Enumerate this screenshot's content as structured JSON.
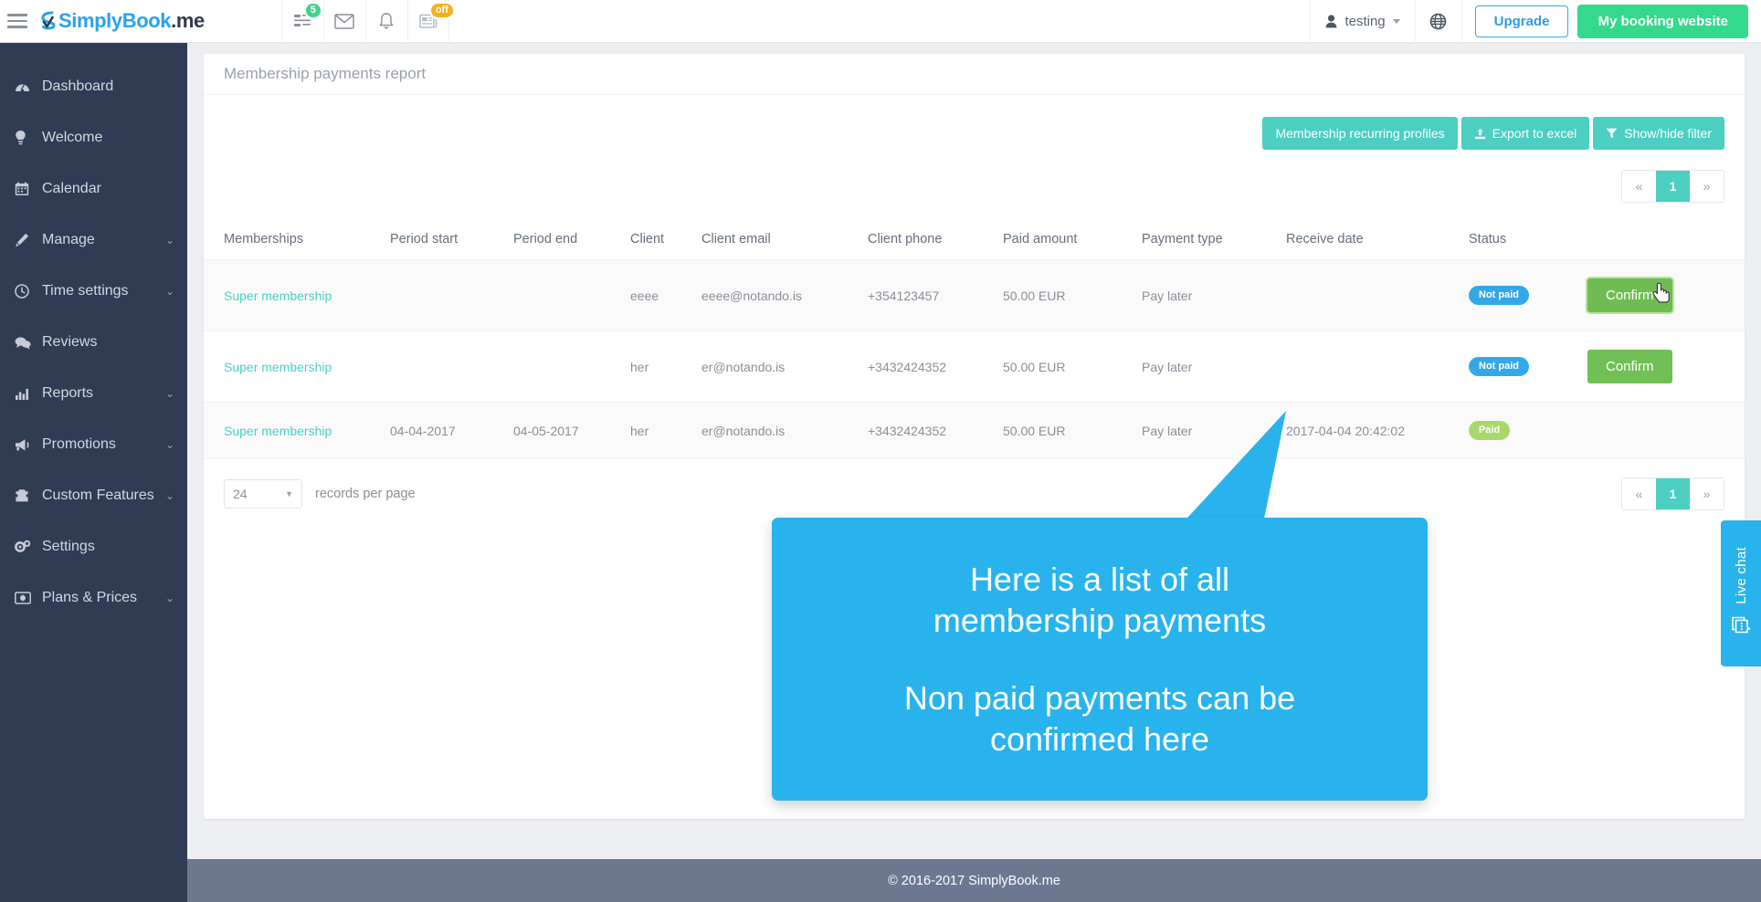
{
  "header": {
    "menu_icon": "hamburger-icon",
    "brand_first": "SimplyBook",
    "brand_second": ".me",
    "icons": [
      {
        "name": "news-feed-icon",
        "badge": "5",
        "badge_color": "#3ed48a"
      },
      {
        "name": "mail-icon",
        "badge": "",
        "badge_color": ""
      },
      {
        "name": "bell-icon",
        "badge": "",
        "badge_color": ""
      },
      {
        "name": "newspaper-icon",
        "badge": "off",
        "badge_color": "#f5b01f"
      }
    ],
    "user_label": "testing",
    "globe_icon": "globe-icon",
    "upgrade_label": "Upgrade",
    "booking_label": "My booking website",
    "accent_blue": "#2f9ae8",
    "accent_green": "#35d98c"
  },
  "sidebar": {
    "items": [
      {
        "label": "Dashboard",
        "icon": "dashboard-icon",
        "arrow": ""
      },
      {
        "label": "Welcome",
        "icon": "bulb-icon",
        "arrow": ""
      },
      {
        "label": "Calendar",
        "icon": "calendar-icon",
        "arrow": ""
      },
      {
        "label": "Manage",
        "icon": "pencil-icon",
        "arrow": "⌄"
      },
      {
        "label": "Time settings",
        "icon": "clock-icon",
        "arrow": "⌄"
      },
      {
        "label": "Reviews",
        "icon": "comments-icon",
        "arrow": ""
      },
      {
        "label": "Reports",
        "icon": "bar-chart-icon",
        "arrow": "⌄"
      },
      {
        "label": "Promotions",
        "icon": "megaphone-icon",
        "arrow": "⌄"
      },
      {
        "label": "Custom Features",
        "icon": "puzzle-icon",
        "arrow": "⌄"
      },
      {
        "label": "Settings",
        "icon": "gears-icon",
        "arrow": ""
      },
      {
        "label": "Plans & Prices",
        "icon": "money-icon",
        "arrow": "⌄"
      }
    ]
  },
  "page": {
    "title": "Membership payments report"
  },
  "toolbar": {
    "recurring_profiles_label": "Membership recurring profiles",
    "export_label": "Export to excel",
    "export_icon": "upload-icon",
    "filter_label": "Show/hide filter",
    "filter_icon": "funnel-icon",
    "button_color": "#4ccfc1"
  },
  "pagination": {
    "prev": "«",
    "next": "»",
    "current": "1"
  },
  "table": {
    "columns": [
      "Memberships",
      "Period start",
      "Period end",
      "Client",
      "Client email",
      "Client phone",
      "Paid amount",
      "Payment type",
      "Receive date",
      "Status",
      ""
    ],
    "rows": [
      {
        "membership": "Super membership",
        "period_start": "",
        "period_end": "",
        "client": "eeee",
        "client_email": "eeee@notando.is",
        "client_phone": "+354123457",
        "paid_amount": "50.00 EUR",
        "payment_type": "Pay later",
        "receive_date": "",
        "status": "Not paid",
        "status_kind": "notpaid",
        "action": "Confirm",
        "action_hovered": true
      },
      {
        "membership": "Super membership",
        "period_start": "",
        "period_end": "",
        "client": "her",
        "client_email": "er@notando.is",
        "client_phone": "+3432424352",
        "paid_amount": "50.00 EUR",
        "payment_type": "Pay later",
        "receive_date": "",
        "status": "Not paid",
        "status_kind": "notpaid",
        "action": "Confirm",
        "action_hovered": false
      },
      {
        "membership": "Super membership",
        "period_start": "04-04-2017",
        "period_end": "04-05-2017",
        "client": "her",
        "client_email": "er@notando.is",
        "client_phone": "+3432424352",
        "paid_amount": "50.00 EUR",
        "payment_type": "Pay later",
        "receive_date": "2017-04-04 20:42:02",
        "status": "Paid",
        "status_kind": "paid",
        "action": "",
        "action_hovered": false
      }
    ]
  },
  "records_per_page": {
    "value": "24",
    "label": "records per page"
  },
  "callout": {
    "line1": "Here is a list of all",
    "line2": "membership payments",
    "line3": "Non paid payments can be",
    "line4": "confirmed here",
    "color": "#29b3ed"
  },
  "live_chat": {
    "label": "Live chat",
    "icon": "chat-icon",
    "color": "#29b3ed"
  },
  "footer": {
    "copyright": "© 2016-2017 SimplyBook.me"
  }
}
